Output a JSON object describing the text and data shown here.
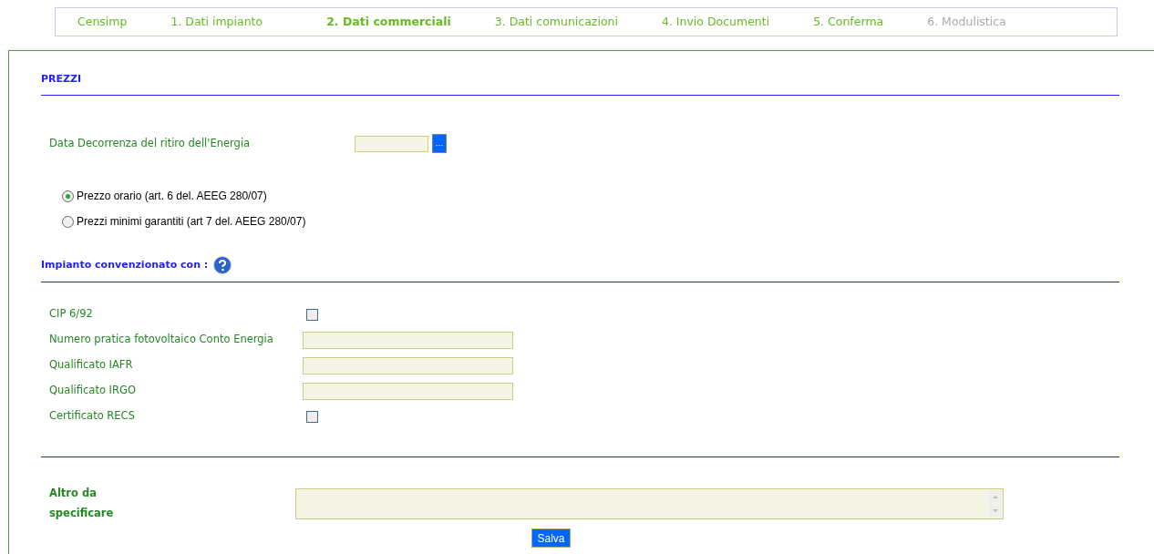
{
  "steps": [
    {
      "label": "Censimp",
      "selected": false,
      "disabled": false
    },
    {
      "label": "1. Dati impianto",
      "selected": false,
      "disabled": false
    },
    {
      "label": "2. Dati commerciali",
      "selected": true,
      "disabled": false
    },
    {
      "label": "3. Dati comunicazioni",
      "selected": false,
      "disabled": false
    },
    {
      "label": "4. Invio Documenti",
      "selected": false,
      "disabled": false
    },
    {
      "label": "5. Conferma",
      "selected": false,
      "disabled": false
    },
    {
      "label": "6. Modulistica",
      "selected": false,
      "disabled": true
    }
  ],
  "prezzi": {
    "title": "PREZZI",
    "date_label": "Data Decorrenza del ritiro dell'Energia",
    "date_button": "...",
    "options": [
      {
        "label": "Prezzo orario (art. 6 del. AEEG 280/07)",
        "selected": true
      },
      {
        "label": "Prezzi minimi garantiti (art 7 del. AEEG 280/07)",
        "selected": false
      }
    ]
  },
  "convenzione": {
    "title": "Impianto convenzionato con :",
    "rows": [
      {
        "kind": "checkbox",
        "label": "CIP 6/92",
        "checked": false
      },
      {
        "kind": "text",
        "label": "Numero pratica fotovoltaico Conto Energia"
      },
      {
        "kind": "text",
        "label": "Qualificato IAFR"
      },
      {
        "kind": "text",
        "label": "Qualificato IRGO"
      },
      {
        "kind": "checkbox",
        "label": "Certificato RECS",
        "checked": false
      }
    ]
  },
  "altro": {
    "label": "Altro da specificare"
  },
  "save_button": "Salva"
}
